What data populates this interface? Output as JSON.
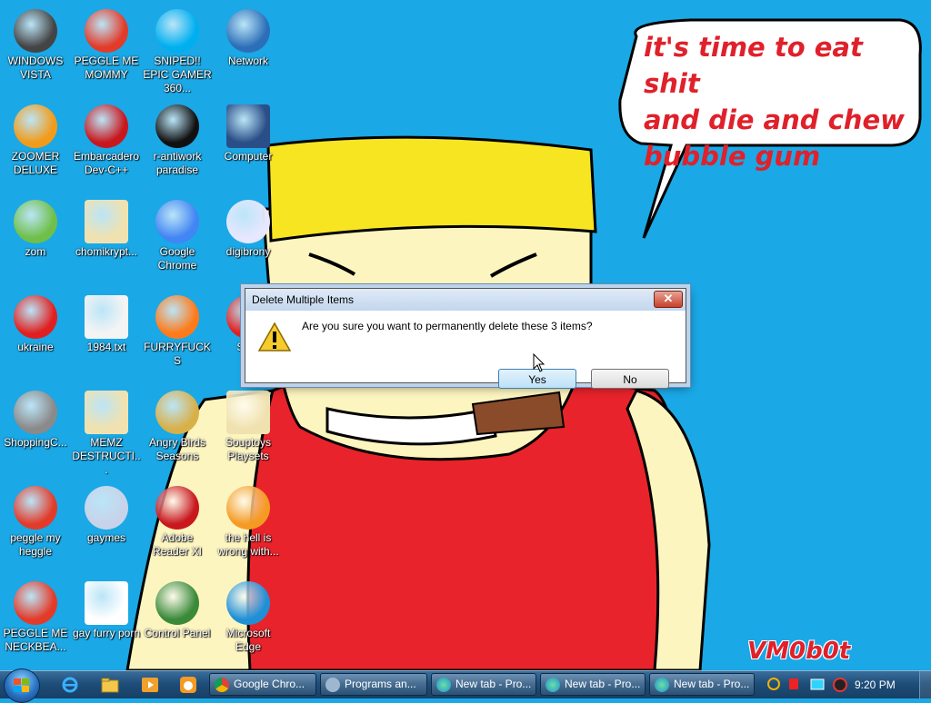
{
  "wallpaper": {
    "speech_text": [
      "it's time to eat shit",
      "and die and chew",
      "bubble gum"
    ],
    "signature": "VM0b0t"
  },
  "desktop_icons": [
    {
      "label": "WINDOWS VISTA",
      "icon": "windows-vista-icon"
    },
    {
      "label": "PEGGLE ME MOMMY",
      "icon": "peggle-icon"
    },
    {
      "label": "SNIPED!! EPIC GAMER 360...",
      "icon": "skype-icon"
    },
    {
      "label": "Network",
      "icon": "network-icon"
    },
    {
      "label": "ZOOMER DELUXE",
      "icon": "zoomer-icon"
    },
    {
      "label": "Embarcadero Dev-C++",
      "icon": "devcpp-icon"
    },
    {
      "label": "r-antiwork paradise",
      "icon": "antiwork-icon"
    },
    {
      "label": "Computer",
      "icon": "computer-icon"
    },
    {
      "label": "zom",
      "icon": "zombie-plant-icon"
    },
    {
      "label": "chomikrypt...",
      "icon": "executable-icon"
    },
    {
      "label": "Google Chrome",
      "icon": "chrome-icon"
    },
    {
      "label": "digibrony",
      "icon": "pony-icon"
    },
    {
      "label": "ukraine",
      "icon": "radiation-icon"
    },
    {
      "label": "1984.txt",
      "icon": "text-file-icon"
    },
    {
      "label": "FURRYFUCKS",
      "icon": "firefox-icon"
    },
    {
      "label": "SOY",
      "icon": "soy-icon"
    },
    {
      "label": "ShoppingC...",
      "icon": "flash-icon"
    },
    {
      "label": "MEMZ DESTRUCTI...",
      "icon": "executable-icon"
    },
    {
      "label": "Angry Birds Seasons",
      "icon": "angry-birds-icon"
    },
    {
      "label": "Souptoys Playsets",
      "icon": "executable-icon"
    },
    {
      "label": "peggle my heggle",
      "icon": "peggle-icon"
    },
    {
      "label": "gaymes",
      "icon": "games-icon"
    },
    {
      "label": "Adobe Reader XI",
      "icon": "adobe-reader-icon"
    },
    {
      "label": "the hell is wrong with...",
      "icon": "uc-browser-icon"
    },
    {
      "label": "PEGGLE ME NECKBEA...",
      "icon": "peggle-icon"
    },
    {
      "label": "gay furry porn",
      "icon": "document-icon"
    },
    {
      "label": "Control Panel",
      "icon": "control-panel-icon"
    },
    {
      "label": "Microsoft Edge",
      "icon": "edge-icon"
    }
  ],
  "dialog": {
    "title": "Delete Multiple Items",
    "message": "Are you sure you want to permanently delete these 3 items?",
    "yes_label": "Yes",
    "no_label": "No",
    "close_glyph": "✕"
  },
  "taskbar": {
    "windows": [
      {
        "label": "Google Chro...",
        "icon": "chrome-icon"
      },
      {
        "label": "Programs an...",
        "icon": "programs-icon"
      },
      {
        "label": "New tab - Pro...",
        "icon": "edge-icon"
      },
      {
        "label": "New tab - Pro...",
        "icon": "edge-icon"
      },
      {
        "label": "New tab - Pro...",
        "icon": "edge-icon"
      }
    ],
    "clock": "9:20 PM"
  },
  "colors": {
    "desktop_bg": "#1aa8e6",
    "speech_text": "#e0202a"
  }
}
